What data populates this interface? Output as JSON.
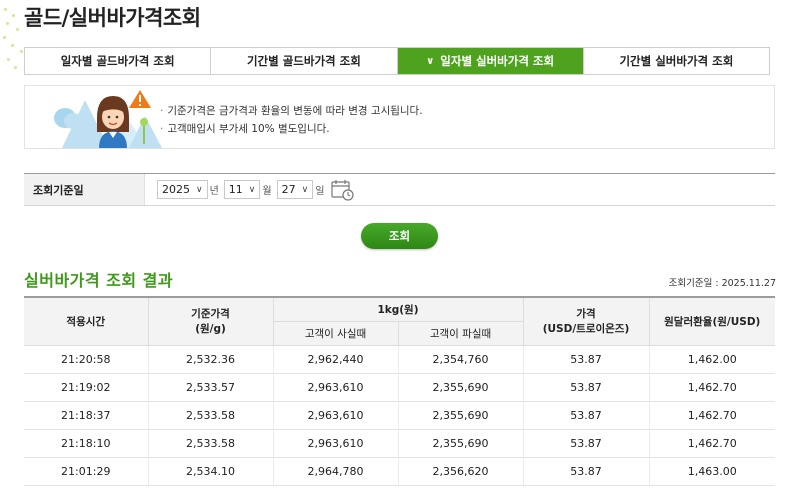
{
  "page": {
    "title": "골드/실버바가격조회"
  },
  "tabs": [
    {
      "label": "일자별 골드바가격 조회",
      "active": false
    },
    {
      "label": "기간별 골드바가격 조회",
      "active": false
    },
    {
      "label": "일자별 실버바가격 조회",
      "active": true
    },
    {
      "label": "기간별 실버바가격 조회",
      "active": false
    }
  ],
  "notice": {
    "items": [
      "기준가격은 금가격과 환율의 변동에 따라 변경 고시됩니다.",
      "고객매입시 부가세 10% 별도입니다."
    ]
  },
  "search": {
    "label": "조회기준일",
    "year": "2025",
    "year_unit": "년",
    "month": "11",
    "month_unit": "월",
    "day": "27",
    "day_unit": "일",
    "button": "조회"
  },
  "result": {
    "title": "실버바가격 조회 결과",
    "date_label": "조회기준일 : 2025.11.27",
    "headers": {
      "time": "적용시간",
      "base_price": "기준가격",
      "base_price_unit": "(원/g)",
      "kg": "1kg(원)",
      "buy": "고객이 사실때",
      "sell": "고객이 파실때",
      "usd_price": "가격",
      "usd_price_unit": "(USD/트로이온즈)",
      "fx": "원달러환율(원/USD)"
    },
    "rows": [
      {
        "time": "21:20:58",
        "base": "2,532.36",
        "buy": "2,962,440",
        "sell": "2,354,760",
        "usd": "53.87",
        "fx": "1,462.00"
      },
      {
        "time": "21:19:02",
        "base": "2,533.57",
        "buy": "2,963,610",
        "sell": "2,355,690",
        "usd": "53.87",
        "fx": "1,462.70"
      },
      {
        "time": "21:18:37",
        "base": "2,533.58",
        "buy": "2,963,610",
        "sell": "2,355,690",
        "usd": "53.87",
        "fx": "1,462.70"
      },
      {
        "time": "21:18:10",
        "base": "2,533.58",
        "buy": "2,963,610",
        "sell": "2,355,690",
        "usd": "53.87",
        "fx": "1,462.70"
      },
      {
        "time": "21:01:29",
        "base": "2,534.10",
        "buy": "2,964,780",
        "sell": "2,356,620",
        "usd": "53.87",
        "fx": "1,463.00"
      }
    ]
  },
  "colors": {
    "accent": "#4ea21e",
    "title_green": "#3f9a1a"
  }
}
